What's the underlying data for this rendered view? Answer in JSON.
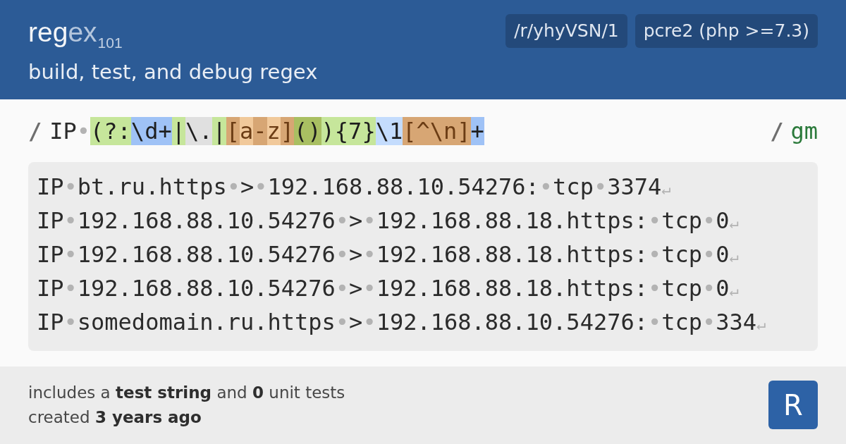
{
  "header": {
    "logo": [
      {
        "kind": "bright",
        "text": "reg"
      },
      {
        "kind": "dim",
        "text": "ex"
      },
      {
        "kind": "subscript",
        "text": "101"
      }
    ],
    "tagline": "build, test, and debug regex",
    "badges": [
      "/r/yhyVSN/1",
      "pcre2 (php >=7.3)"
    ]
  },
  "regex": {
    "open_delimiter": "/",
    "tokens": [
      {
        "kind": "literal",
        "text": "IP"
      },
      {
        "kind": "space",
        "text": "•"
      },
      {
        "kind": "group",
        "text": "(?:",
        "color": "#c6e69b"
      },
      {
        "kind": "meta",
        "text": "\\d+",
        "color": "#9fc2f6"
      },
      {
        "kind": "group",
        "text": "|",
        "color": "#c6e69b"
      },
      {
        "kind": "escape",
        "text": "\\.",
        "color": "#e0e0e0"
      },
      {
        "kind": "group",
        "text": "|",
        "color": "#c6e69b"
      },
      {
        "kind": "class",
        "text": "[",
        "color": "#d7a674"
      },
      {
        "kind": "class",
        "text": "a",
        "color": "#f1c99b"
      },
      {
        "kind": "class",
        "text": "-",
        "color": "#d7a674"
      },
      {
        "kind": "class",
        "text": "z",
        "color": "#f1c99b"
      },
      {
        "kind": "class",
        "text": "]",
        "color": "#d7a674"
      },
      {
        "kind": "group",
        "text": "()",
        "color": "#a9bf62"
      },
      {
        "kind": "group",
        "text": "){7}",
        "color": "#c6e69b"
      },
      {
        "kind": "backref",
        "text": "\\1",
        "color": "#c4dcfd"
      },
      {
        "kind": "class",
        "text": "[^\\n]",
        "color": "#d7a674"
      },
      {
        "kind": "meta",
        "text": "+",
        "color": "#9fc2f6"
      }
    ],
    "close_delimiter": "/",
    "flags": "gm"
  },
  "test_string": {
    "lines": [
      {
        "segments": [
          {
            "kind": "text",
            "text": "IP"
          },
          {
            "kind": "space",
            "text": "•"
          },
          {
            "kind": "text",
            "text": "bt.ru.https"
          },
          {
            "kind": "space",
            "text": "•"
          },
          {
            "kind": "text",
            "text": ">"
          },
          {
            "kind": "space",
            "text": "•"
          },
          {
            "kind": "text",
            "text": "192.168.88.10.54276:"
          },
          {
            "kind": "space",
            "text": "•"
          },
          {
            "kind": "text",
            "text": "tcp"
          },
          {
            "kind": "space",
            "text": "•"
          },
          {
            "kind": "text",
            "text": "3374"
          },
          {
            "kind": "newline",
            "text": "↵"
          }
        ]
      },
      {
        "segments": [
          {
            "kind": "text",
            "text": "IP"
          },
          {
            "kind": "space",
            "text": "•"
          },
          {
            "kind": "text",
            "text": "192.168.88.10.54276"
          },
          {
            "kind": "space",
            "text": "•"
          },
          {
            "kind": "text",
            "text": ">"
          },
          {
            "kind": "space",
            "text": "•"
          },
          {
            "kind": "text",
            "text": "192.168.88.18.https:"
          },
          {
            "kind": "space",
            "text": "•"
          },
          {
            "kind": "text",
            "text": "tcp"
          },
          {
            "kind": "space",
            "text": "•"
          },
          {
            "kind": "text",
            "text": "0"
          },
          {
            "kind": "newline",
            "text": "↵"
          }
        ]
      },
      {
        "segments": [
          {
            "kind": "text",
            "text": "IP"
          },
          {
            "kind": "space",
            "text": "•"
          },
          {
            "kind": "text",
            "text": "192.168.88.10.54276"
          },
          {
            "kind": "space",
            "text": "•"
          },
          {
            "kind": "text",
            "text": ">"
          },
          {
            "kind": "space",
            "text": "•"
          },
          {
            "kind": "text",
            "text": "192.168.88.18.https:"
          },
          {
            "kind": "space",
            "text": "•"
          },
          {
            "kind": "text",
            "text": "tcp"
          },
          {
            "kind": "space",
            "text": "•"
          },
          {
            "kind": "text",
            "text": "0"
          },
          {
            "kind": "newline",
            "text": "↵"
          }
        ]
      },
      {
        "segments": [
          {
            "kind": "text",
            "text": "IP"
          },
          {
            "kind": "space",
            "text": "•"
          },
          {
            "kind": "text",
            "text": "192.168.88.10.54276"
          },
          {
            "kind": "space",
            "text": "•"
          },
          {
            "kind": "text",
            "text": ">"
          },
          {
            "kind": "space",
            "text": "•"
          },
          {
            "kind": "text",
            "text": "192.168.88.18.https:"
          },
          {
            "kind": "space",
            "text": "•"
          },
          {
            "kind": "text",
            "text": "tcp"
          },
          {
            "kind": "space",
            "text": "•"
          },
          {
            "kind": "text",
            "text": "0"
          },
          {
            "kind": "newline",
            "text": "↵"
          }
        ]
      },
      {
        "segments": [
          {
            "kind": "text",
            "text": "IP"
          },
          {
            "kind": "space",
            "text": "•"
          },
          {
            "kind": "text",
            "text": "somedomain.ru.https"
          },
          {
            "kind": "space",
            "text": "•"
          },
          {
            "kind": "text",
            "text": ">"
          },
          {
            "kind": "space",
            "text": "•"
          },
          {
            "kind": "text",
            "text": "192.168.88.10.54276:"
          },
          {
            "kind": "space",
            "text": "•"
          },
          {
            "kind": "text",
            "text": "tcp"
          },
          {
            "kind": "space",
            "text": "•"
          },
          {
            "kind": "text",
            "text": "334"
          },
          {
            "kind": "newline",
            "text": "↵"
          }
        ]
      }
    ]
  },
  "footer": {
    "lines": [
      "includes a **test string** and **0** unit tests",
      "created **3 years ago**"
    ],
    "logo_letter": "R"
  }
}
